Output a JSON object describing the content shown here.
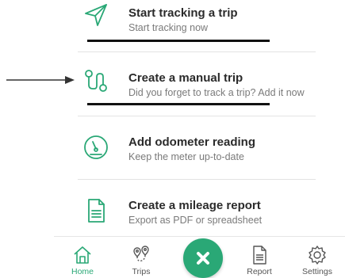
{
  "menu": {
    "items": [
      {
        "title": "Start tracking a trip",
        "subtitle": "Start tracking now",
        "icon": "send-icon"
      },
      {
        "title": "Create a manual trip",
        "subtitle": "Did you forget to track a trip? Add it now",
        "icon": "route-icon"
      },
      {
        "title": "Add odometer reading",
        "subtitle": "Keep the meter up-to-date",
        "icon": "gauge-icon"
      },
      {
        "title": "Create a mileage report",
        "subtitle": "Export as PDF or spreadsheet",
        "icon": "document-icon"
      }
    ]
  },
  "nav": {
    "home": "Home",
    "trips": "Trips",
    "report": "Report",
    "settings": "Settings"
  },
  "colors": {
    "accent": "#2aa876",
    "title": "#2b2b2b",
    "subtitle": "#7a7a7a"
  }
}
